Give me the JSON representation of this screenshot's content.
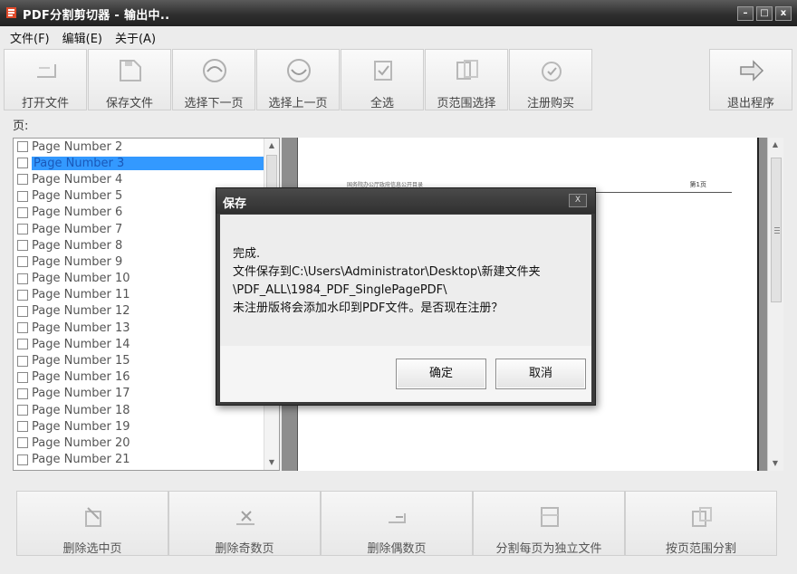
{
  "window": {
    "title": "PDF分割剪切器 - 输出中..",
    "controls": {
      "minimize": "–",
      "maximize": "□",
      "close": "x"
    }
  },
  "menu": [
    "文件(F)",
    "编辑(E)",
    "关于(A)"
  ],
  "toolbar": {
    "buttons": [
      {
        "label": "打开文件",
        "icon": "open-file-icon"
      },
      {
        "label": "保存文件",
        "icon": "save-file-icon"
      },
      {
        "label": "选择下一页",
        "icon": "next-page-icon"
      },
      {
        "label": "选择上一页",
        "icon": "previous-page-icon"
      },
      {
        "label": "全选",
        "icon": "select-all-icon"
      },
      {
        "label": "页范围选择",
        "icon": "page-range-icon"
      },
      {
        "label": "注册购买",
        "icon": "register-icon"
      }
    ],
    "exit_label": "退出程序"
  },
  "page_label": "页:",
  "pages": {
    "items": [
      "Page Number 2",
      "Page Number 3",
      "Page Number 4",
      "Page Number 5",
      "Page Number 6",
      "Page Number 7",
      "Page Number 8",
      "Page Number 9",
      "Page Number 10",
      "Page Number 11",
      "Page Number 12",
      "Page Number 13",
      "Page Number 14",
      "Page Number 15",
      "Page Number 16",
      "Page Number 17",
      "Page Number 18",
      "Page Number 19",
      "Page Number 20",
      "Page Number 21"
    ],
    "selected_index": 1
  },
  "preview": {
    "header_text": "国务院办公厅政府信息公开目录",
    "page_number": "第1页"
  },
  "bottom_buttons": [
    {
      "label": "删除选中页",
      "icon": "delete-selected-icon"
    },
    {
      "label": "删除奇数页",
      "icon": "delete-odd-icon"
    },
    {
      "label": "删除偶数页",
      "icon": "delete-even-icon"
    },
    {
      "label": "分割每页为独立文件",
      "icon": "split-each-page-icon"
    },
    {
      "label": "按页范围分割",
      "icon": "split-range-icon"
    }
  ],
  "dialog": {
    "title": "保存",
    "message_lines": [
      "完成.",
      "文件保存到C:\\Users\\Administrator\\Desktop\\新建文件夹",
      "\\PDF_ALL\\1984_PDF_SinglePagePDF\\",
      "未注册版将会添加水印到PDF文件。是否现在注册？"
    ],
    "ok_label": "确定",
    "cancel_label": "取消",
    "close_glyph": "X"
  }
}
